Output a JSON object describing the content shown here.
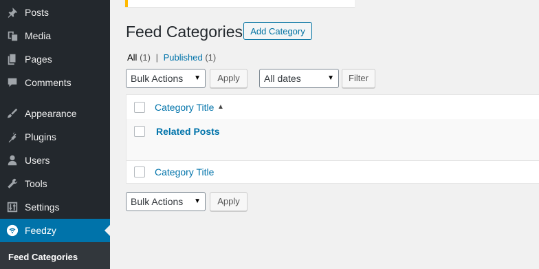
{
  "sidebar": {
    "items": [
      {
        "label": "Posts",
        "icon": "pin-icon"
      },
      {
        "label": "Media",
        "icon": "media-icon"
      },
      {
        "label": "Pages",
        "icon": "pages-icon"
      },
      {
        "label": "Comments",
        "icon": "comment-icon"
      },
      {
        "label": "Appearance",
        "icon": "paintbrush-icon"
      },
      {
        "label": "Plugins",
        "icon": "plug-icon"
      },
      {
        "label": "Users",
        "icon": "user-icon"
      },
      {
        "label": "Tools",
        "icon": "wrench-icon"
      },
      {
        "label": "Settings",
        "icon": "sliders-icon"
      },
      {
        "label": "Feedzy",
        "icon": "wifi-icon",
        "active": true
      }
    ],
    "submenu": {
      "label": "Feed Categories"
    }
  },
  "header": {
    "title": "Feed Categories",
    "add_button": "Add Category"
  },
  "views": {
    "all_label": "All",
    "all_count": "(1)",
    "separator": "|",
    "published_label": "Published",
    "published_count": "(1)"
  },
  "top_controls": {
    "bulk_actions": "Bulk Actions",
    "apply": "Apply",
    "dates": "All dates",
    "filter": "Filter"
  },
  "table": {
    "column_title": "Category Title",
    "sort_indicator": "▲",
    "rows": [
      {
        "title": "Related Posts"
      }
    ],
    "footer_title": "Category Title"
  },
  "bottom_controls": {
    "bulk_actions": "Bulk Actions",
    "apply": "Apply"
  },
  "colors": {
    "sidebar_bg": "#23282d",
    "active_bg": "#0073aa",
    "link": "#0073aa",
    "notice_accent": "#ffb900"
  }
}
